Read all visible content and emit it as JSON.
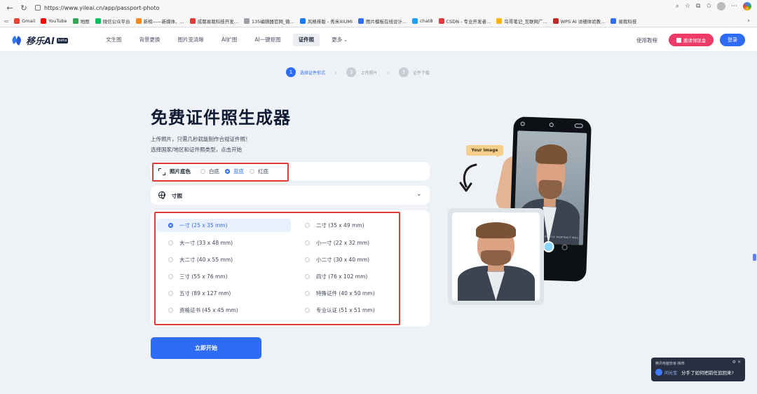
{
  "browser": {
    "url": "https://www.yileai.cn/app/passport-photo",
    "bookmarks": [
      "Gmail",
      "YouTube",
      "地图",
      "微信公众平台",
      "新榜——新媒体、...",
      "成都易我科技开发...",
      "135编辑器官网_微...",
      "风格排版 - 秀米XIUMI",
      "图片模板在线设计...",
      "chat8",
      "CSDN - 专业开发者...",
      "鸟哥笔记_互联网广...",
      "WPS AI 详细体验教...",
      "易我科技"
    ],
    "bookmark_colors": [
      "#ea4335",
      "#ff0000",
      "#34a853",
      "#07c160",
      "#f28a1b",
      "#e53935",
      "#9aa0a6",
      "#1677ff",
      "#2e6cf6",
      "#1da1f2",
      "#e4393c",
      "#f5b400",
      "#c62828",
      "#2e6cf6"
    ]
  },
  "header": {
    "logo_text": "移乐AI",
    "logo_badge": "beta",
    "menu": [
      "文生图",
      "背景更换",
      "图片变清晰",
      "AI扩图",
      "AI一键抠图",
      "证件照",
      "更多"
    ],
    "active_menu": "证件照",
    "tutorial": "使用教程",
    "invite": "邀请领现金",
    "login": "登录"
  },
  "steps": [
    {
      "num": "1",
      "label": "选择证件形式",
      "active": true
    },
    {
      "num": "2",
      "label": "上传照片",
      "active": false
    },
    {
      "num": "3",
      "label": "证件下载",
      "active": false
    }
  ],
  "hero": {
    "title": "免费证件照生成器",
    "desc_line1": "上传照片，只需几秒就能制作合规证件照！",
    "desc_line2": "选择国家/地区和证件照类型，点击开始"
  },
  "background_color": {
    "label": "照片底色",
    "options": [
      "白底",
      "蓝底",
      "红底"
    ],
    "selected": "蓝底"
  },
  "size_field": {
    "label": "寸照"
  },
  "sizes": {
    "left": [
      "一寸 (25 x 35 mm)",
      "大一寸 (33 x 48 mm)",
      "大二寸 (40 x 55 mm)",
      "三寸 (55 x 76 mm)",
      "五寸 (89 x 127 mm)",
      "资格证书 (45 x 45 mm)"
    ],
    "right": [
      "二寸 (35 x 49 mm)",
      "小一寸 (22 x 32 mm)",
      "小二寸 (30 x 40 mm)",
      "四寸 (76 x 102 mm)",
      "特殊证件 (40 x 50 mm)",
      "专业认证 (51 x 51 mm)"
    ],
    "selected": "一寸 (25 x 35 mm)"
  },
  "start_button": "立即开始",
  "illustration": {
    "tag": "Your Image",
    "phone_modes": "PHOTO  PORTRAIT  MAC"
  },
  "notification": {
    "title": "腾讯电脑管家-推荐",
    "app": "问元宝",
    "text": "分手了如何把前任追回来?"
  },
  "colors": {
    "accent": "#2e6cf6",
    "invite": "#ee3a66",
    "highlight_box": "#e43a3a"
  }
}
